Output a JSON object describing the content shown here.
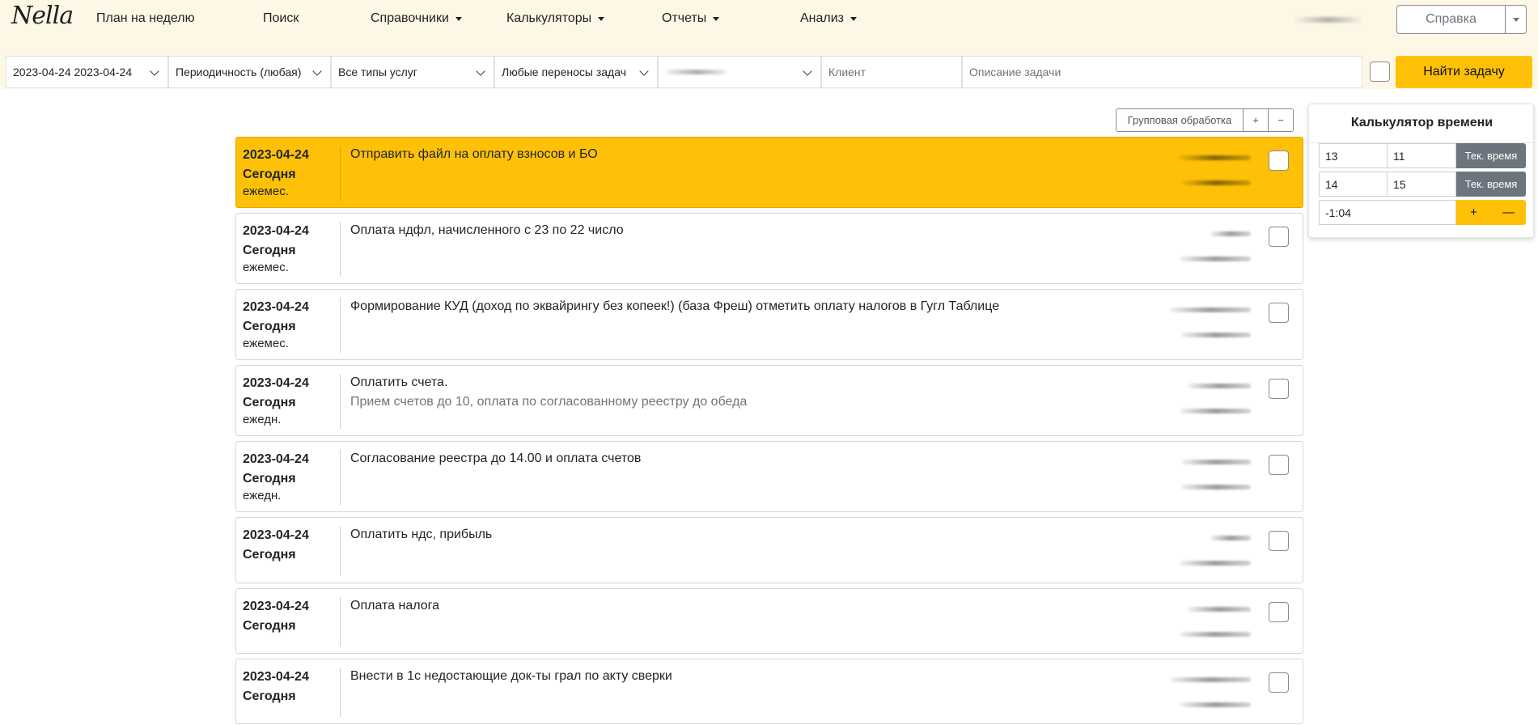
{
  "nav": {
    "brand": "Nella",
    "items": [
      {
        "label": "План на неделю",
        "dropdown": false
      },
      {
        "label": "Поиск",
        "dropdown": false
      },
      {
        "label": "Справочники",
        "dropdown": true
      },
      {
        "label": "Калькуляторы",
        "dropdown": true
      },
      {
        "label": "Отчеты",
        "dropdown": true
      },
      {
        "label": "Анализ",
        "dropdown": true
      }
    ],
    "help_label": "Справка"
  },
  "filters": {
    "date_range": "2023-04-24 2023-04-24",
    "periodicity": "Периодичность (любая)",
    "service_types": "Все типы услуг",
    "transfers": "Любые переносы задач",
    "client_placeholder": "Клиент",
    "description_placeholder": "Описание задачи",
    "find_label": "Найти задачу"
  },
  "group": {
    "label": "Групповая обработка",
    "plus": "+",
    "minus": "−"
  },
  "tasks": [
    {
      "date": "2023-04-24",
      "day": "Сегодня",
      "period": "ежемес.",
      "title": "Отправить файл на оплату взносов и БО",
      "note": "",
      "active": true
    },
    {
      "date": "2023-04-24",
      "day": "Сегодня",
      "period": "ежемес.",
      "title": "Оплата ндфл, начисленного с 23 по 22 число",
      "note": "",
      "active": false
    },
    {
      "date": "2023-04-24",
      "day": "Сегодня",
      "period": "ежемес.",
      "title": "Формирование КУД (доход по эквайрингу без копеек!) (база Фреш) отметить оплату налогов в Гугл Таблице",
      "note": "",
      "active": false
    },
    {
      "date": "2023-04-24",
      "day": "Сегодня",
      "period": "ежедн.",
      "title": "Оплатить счета.",
      "note": "Прием счетов до 10, оплата по согласованному реестру до обеда",
      "active": false
    },
    {
      "date": "2023-04-24",
      "day": "Сегодня",
      "period": "ежедн.",
      "title": "Согласование реестра до 14.00 и оплата счетов",
      "note": "",
      "active": false
    },
    {
      "date": "2023-04-24",
      "day": "Сегодня",
      "period": "",
      "title": "Оплатить ндс, прибыль",
      "note": "",
      "active": false
    },
    {
      "date": "2023-04-24",
      "day": "Сегодня",
      "period": "",
      "title": "Оплата налога",
      "note": "",
      "active": false
    },
    {
      "date": "2023-04-24",
      "day": "Сегодня",
      "period": "",
      "title": "Внести в 1с недостающие док-ты грал по акту сверки",
      "note": "",
      "active": false
    }
  ],
  "calculator": {
    "title": "Калькулятор времени",
    "row1": {
      "hours": "13",
      "minutes": "11",
      "now_label": "Тек. время"
    },
    "row2": {
      "hours": "14",
      "minutes": "15",
      "now_label": "Тек. время"
    },
    "result": "-1:04",
    "plus": "+",
    "minus": "—"
  },
  "colors": {
    "navbar_bg": "#fdf8e6",
    "accent": "#ffc107",
    "secondary": "#6c757d"
  }
}
